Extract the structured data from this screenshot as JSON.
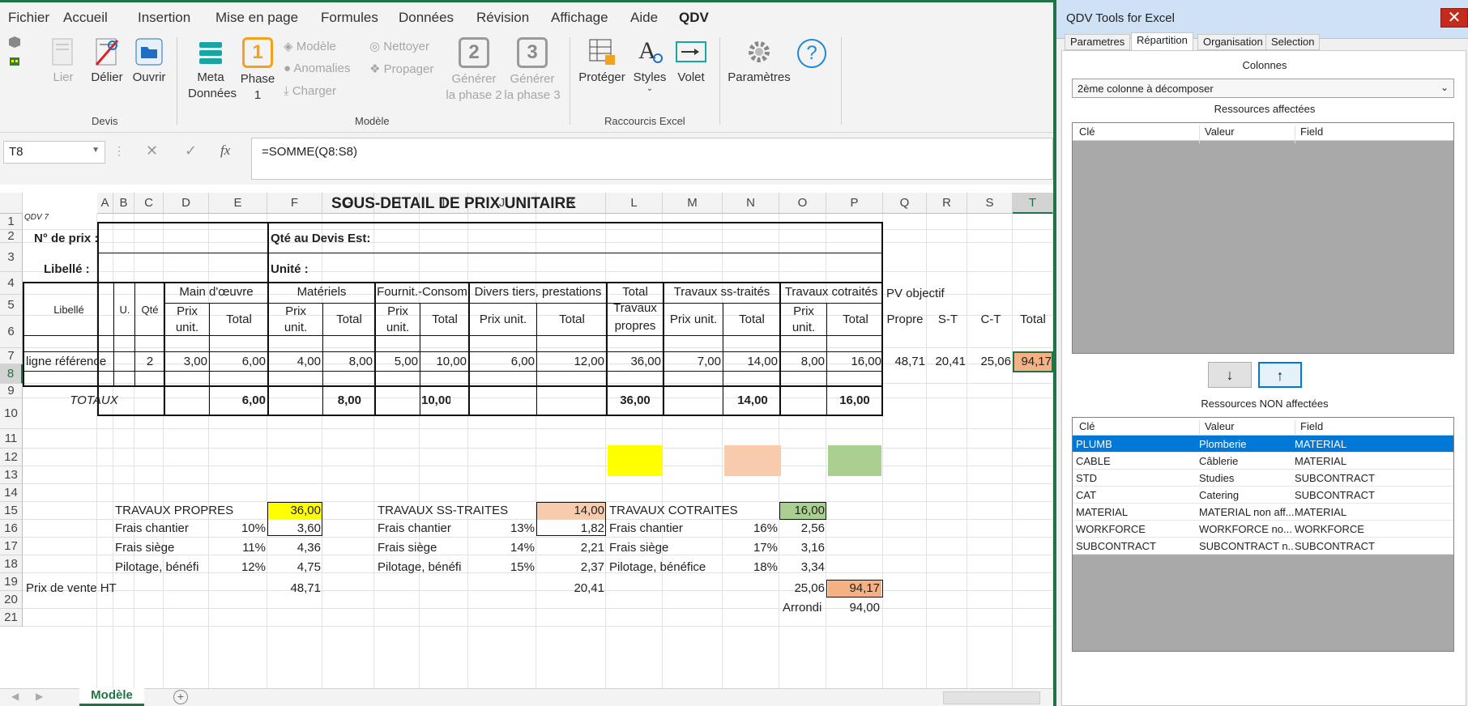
{
  "ribbon": {
    "tabs": [
      "Fichier",
      "Accueil",
      "Insertion",
      "Mise en page",
      "Formules",
      "Données",
      "Révision",
      "Affichage",
      "Aide",
      "QDV"
    ],
    "active_tab": "QDV",
    "devis": {
      "lier": "Lier",
      "delier": "Délier",
      "ouvrir": "Ouvrir",
      "group": "Devis"
    },
    "modele": {
      "meta_l1": "Meta",
      "meta_l2": "Données",
      "phase_l1": "Phase",
      "phase_l2": "1",
      "modele": "Modèle",
      "anomalies": "Anomalies",
      "charger": "Charger",
      "nettoyer": "Nettoyer",
      "propager": "Propager",
      "gen2_l1": "Générer",
      "gen2_l2": "la phase 2",
      "gen3_l1": "Générer",
      "gen3_l2": "la phase 3",
      "phase1_num": "1",
      "phase2_num": "2",
      "phase3_num": "3",
      "group": "Modèle"
    },
    "raccourcis": {
      "proteger": "Protéger",
      "styles": "Styles",
      "volet": "Volet",
      "group": "Raccourcis Excel"
    },
    "parametres": "Paramètres"
  },
  "formula_bar": {
    "name_box": "T8",
    "fx": "fx",
    "formula": "=SOMME(Q8:S8)"
  },
  "columns": [
    "A",
    "B",
    "C",
    "D",
    "E",
    "F",
    "G",
    "H",
    "I",
    "J",
    "K",
    "L",
    "M",
    "N",
    "O",
    "P",
    "Q",
    "R",
    "S",
    "T"
  ],
  "rows": [
    "1",
    "2",
    "3",
    "4",
    "5",
    "6",
    "7",
    "8",
    "9",
    "10",
    "11",
    "12",
    "13",
    "14",
    "15",
    "16",
    "17",
    "18",
    "19",
    "20",
    "21"
  ],
  "sheet": {
    "title": "SOUS-DETAIL DE PRIX UNITAIRE",
    "qdv_tag": "QDV 7",
    "no_prix": "N° de prix :",
    "qte_devis": "Qté au Devis Est:",
    "libelle": "Libellé :",
    "unite": "Unité :",
    "headers": {
      "libelle": "Libellé",
      "u": "U.",
      "qte": "Qté",
      "main_oeuvre": "Main d'œuvre",
      "materiels": "Matériels",
      "fournit": "Fournit.-Consom",
      "divers": "Divers tiers, prestations",
      "total_tp_l1": "Total",
      "total_tp_l2": "Travaux",
      "total_tp_l3": "propres",
      "ss_traites": "Travaux ss-traités",
      "cotraites": "Travaux cotraités",
      "pv_objectif": "PV objectif",
      "prix_unit_l1": "Prix",
      "prix_unit_l2": "unit.",
      "prix_unit_one": "Prix unit.",
      "total": "Total",
      "propre": "Propre",
      "st": "S-T",
      "ct": "C-T"
    },
    "row8": {
      "label": "ligne référence",
      "qte": "2",
      "d": "3,00",
      "e": "6,00",
      "f": "4,00",
      "g": "8,00",
      "h": "5,00",
      "i": "10,00",
      "j": "6,00",
      "k": "12,00",
      "l": "36,00",
      "m": "7,00",
      "n": "14,00",
      "o": "8,00",
      "p": "16,00",
      "q": "48,71",
      "r": "20,41",
      "s": "25,06",
      "t": "94,17"
    },
    "totaux": {
      "label": "TOTAUX",
      "e": "6,00",
      "g": "8,00",
      "i": "10,00",
      "l": "36,00",
      "n": "14,00",
      "p": "16,00"
    },
    "recap": {
      "tp": {
        "title": "TRAVAUX PROPRES",
        "total": "36,00",
        "frais_chantier": "Frais chantier",
        "fc_pct": "10%",
        "fc_val": "3,60",
        "frais_siege": "Frais siège",
        "fs_pct": "11%",
        "fs_val": "4,36",
        "pilotage": "Pilotage, bénéfi",
        "pi_pct": "12%",
        "pi_val": "4,75"
      },
      "st": {
        "title": "TRAVAUX SS-TRAITES",
        "total": "14,00",
        "frais_chantier": "Frais chantier",
        "fc_pct": "13%",
        "fc_val": "1,82",
        "frais_siege": "Frais siège",
        "fs_pct": "14%",
        "fs_val": "2,21",
        "pilotage": "Pilotage, bénéfi",
        "pi_pct": "15%",
        "pi_val": "2,37"
      },
      "ct": {
        "title": "TRAVAUX COTRAITES",
        "total": "16,00",
        "frais_chantier": "Frais chantier",
        "fc_pct": "16%",
        "fc_val": "2,56",
        "frais_siege": "Frais siège",
        "fs_pct": "17%",
        "fs_val": "3,16",
        "pilotage": "Pilotage, bénéfice",
        "pi_pct": "18%",
        "pi_val": "3,34"
      },
      "pv_label": "Prix de vente HT",
      "pv_tp": "48,71",
      "pv_st": "20,41",
      "pv_ct": "25,06",
      "pv_total": "94,17",
      "arrondi": "Arrondi",
      "arrondi_val": "94,00"
    }
  },
  "sheet_tabs": {
    "active": "Modèle",
    "add": "+"
  },
  "panel": {
    "title": "QDV Tools for Excel",
    "close": "✕",
    "tabs": [
      "Parametres",
      "Répartition",
      "Organisation",
      "Selection"
    ],
    "active_tab": "Répartition",
    "colonnes_label": "Colonnes",
    "colonnes_value": "2ème colonne à décomposer",
    "affectees_label": "Ressources affectées",
    "non_affectees_label": "Ressources NON affectées",
    "list_headers": [
      "Clé",
      "Valeur",
      "Field"
    ],
    "btn_down": "↓",
    "btn_up": "↑",
    "non_affectees": [
      [
        "PLUMB",
        "Plomberie",
        "MATERIAL"
      ],
      [
        "CABLE",
        "Câblerie",
        "MATERIAL"
      ],
      [
        "STD",
        "Studies",
        "SUBCONTRACT"
      ],
      [
        "CAT",
        "Catering",
        "SUBCONTRACT"
      ],
      [
        "MATERIAL",
        "MATERIAL non aff...",
        "MATERIAL"
      ],
      [
        "WORKFORCE",
        "WORKFORCE no...",
        "WORKFORCE"
      ],
      [
        "SUBCONTRACT",
        "SUBCONTRACT n...",
        "SUBCONTRACT"
      ]
    ]
  },
  "colors": {
    "excel_green": "#217346",
    "yellow": "#ffff00",
    "salmon": "#f8cbad",
    "green_fill": "#a9d08e",
    "orange": "#f4b183",
    "selection_blue": "#0078d7"
  }
}
